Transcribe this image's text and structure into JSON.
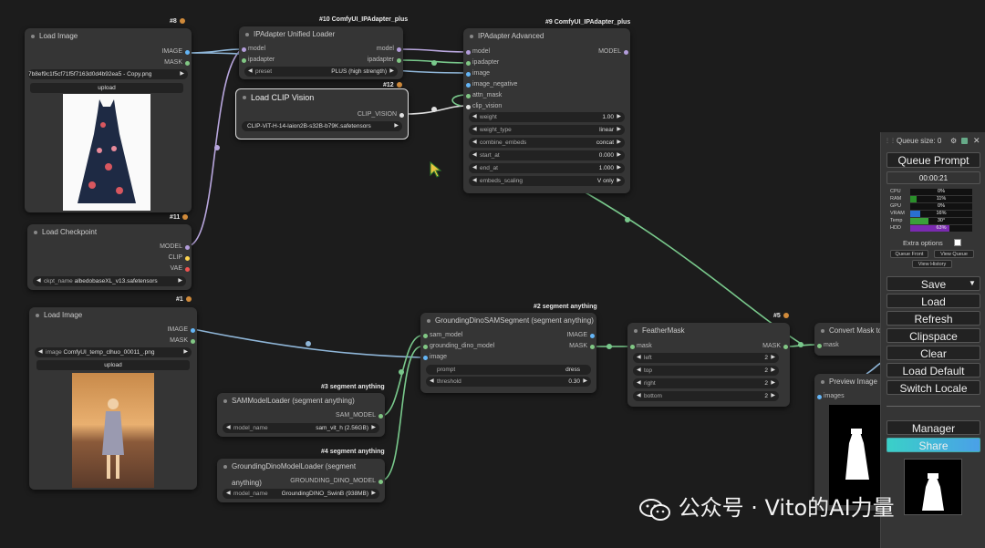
{
  "nodes": {
    "load_image_1": {
      "id": "#8",
      "title": "Load Image",
      "out_image": "IMAGE",
      "out_mask": "MASK",
      "file": "7b8ef9c1f5cf71f5f7163d0d4b92ea5 - Copy.png",
      "upload": "upload"
    },
    "ipadapter_loader": {
      "id": "#10 ComfyUI_IPAdapter_plus",
      "title": "IPAdapter Unified Loader",
      "in_model": "model",
      "in_ipadapter": "ipadapter",
      "out_model": "model",
      "out_ipadapter": "ipadapter",
      "preset_label": "preset",
      "preset_value": "PLUS (high strength)"
    },
    "clip_vision": {
      "id": "#12",
      "title": "Load CLIP Vision",
      "out": "CLIP_VISION",
      "value": "CLIP-ViT-H-14-laion2B-s32B-b79K.safetensors"
    },
    "ipadapter_adv": {
      "id": "#9 ComfyUI_IPAdapter_plus",
      "title": "IPAdapter Advanced",
      "inputs": [
        "model",
        "ipadapter",
        "image",
        "image_negative",
        "attn_mask",
        "clip_vision"
      ],
      "out": "MODEL",
      "widgets": [
        {
          "label": "weight",
          "value": "1.00"
        },
        {
          "label": "weight_type",
          "value": "linear"
        },
        {
          "label": "combine_embeds",
          "value": "concat"
        },
        {
          "label": "start_at",
          "value": "0.000"
        },
        {
          "label": "end_at",
          "value": "1.000"
        },
        {
          "label": "embeds_scaling",
          "value": "V only"
        }
      ]
    },
    "load_checkpoint": {
      "id": "#11",
      "title": "Load Checkpoint",
      "out_model": "MODEL",
      "out_clip": "CLIP",
      "out_vae": "VAE",
      "ckpt_label": "ckpt_name",
      "ckpt_value": "albedobaseXL_v13.safetensors"
    },
    "load_image_2": {
      "id": "#1",
      "title": "Load Image",
      "out_image": "IMAGE",
      "out_mask": "MASK",
      "image_label": "image",
      "file": "ComfyUI_temp_clhuo_00011_.png",
      "upload": "upload"
    },
    "sam_segment": {
      "id": "#2 segment anything",
      "title": "GroundingDinoSAMSegment (segment anything)",
      "inputs": [
        "sam_model",
        "grounding_dino_model",
        "image"
      ],
      "out_image": "IMAGE",
      "out_mask": "MASK",
      "prompt_label": "prompt",
      "prompt_value": "dress",
      "threshold_label": "threshold",
      "threshold_value": "0.30"
    },
    "sam_loader": {
      "id": "#3 segment anything",
      "title": "SAMModelLoader (segment anything)",
      "out": "SAM_MODEL",
      "label": "model_name",
      "value": "sam_vit_h (2.56GB)"
    },
    "dino_loader": {
      "id": "#4 segment anything",
      "title": "GroundingDinoModelLoader (segment anything)",
      "out": "GROUNDING_DINO_MODEL",
      "label": "model_name",
      "value": "GroundingDINO_SwinB (938MB)"
    },
    "feather_mask": {
      "id": "#5",
      "title": "FeatherMask",
      "in": "mask",
      "out": "MASK",
      "widgets": [
        {
          "label": "left",
          "value": "2"
        },
        {
          "label": "top",
          "value": "2"
        },
        {
          "label": "right",
          "value": "2"
        },
        {
          "label": "bottom",
          "value": "2"
        }
      ]
    },
    "convert_mask": {
      "title": "Convert Mask to",
      "in": "mask"
    },
    "preview_image": {
      "title": "Preview Image",
      "in": "images"
    }
  },
  "panel": {
    "queue_size": "Queue size: 0",
    "queue_prompt": "Queue Prompt",
    "timer": "00:00:21",
    "stats": [
      {
        "label": "CPU",
        "value": "0%",
        "fill": 0.0,
        "color": "#2a8f2a"
      },
      {
        "label": "RAM",
        "value": "11%",
        "fill": 0.11,
        "color": "#2a8f2a"
      },
      {
        "label": "GPU",
        "value": "0%",
        "fill": 0.0,
        "color": "#2a8f2a"
      },
      {
        "label": "VRAM",
        "value": "16%",
        "fill": 0.16,
        "color": "#2a6fd0"
      },
      {
        "label": "Temp",
        "value": "30°",
        "fill": 0.3,
        "color": "#3aa03a"
      },
      {
        "label": "HDD",
        "value": "63%",
        "fill": 0.63,
        "color": "#7a2ab0"
      }
    ],
    "extra_options": "Extra options",
    "queue_front": "Queue Front",
    "view_queue": "View Queue",
    "view_history": "View History",
    "buttons": [
      "Save",
      "Load",
      "Refresh",
      "Clipspace",
      "Clear",
      "Load Default",
      "Switch Locale"
    ],
    "manager": "Manager",
    "share": "Share"
  },
  "watermark": "公众号 · Vito的AI力量"
}
